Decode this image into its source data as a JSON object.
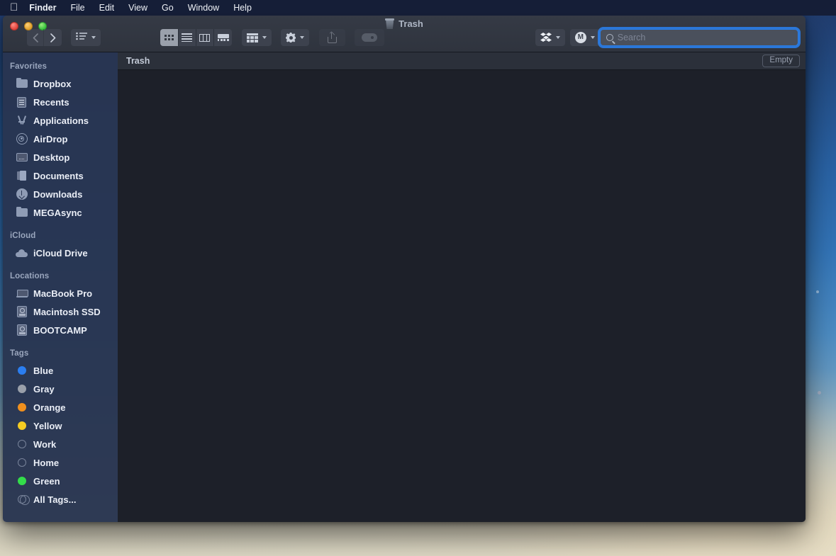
{
  "menubar": {
    "apple_icon": "apple-logo-icon",
    "items": [
      {
        "label": "Finder",
        "bold": true
      },
      {
        "label": "File",
        "bold": false
      },
      {
        "label": "Edit",
        "bold": false
      },
      {
        "label": "View",
        "bold": false
      },
      {
        "label": "Go",
        "bold": false
      },
      {
        "label": "Window",
        "bold": false
      },
      {
        "label": "Help",
        "bold": false
      }
    ]
  },
  "window": {
    "title": "Trash",
    "title_icon": "trash-can-icon",
    "traffic_lights": {
      "close": "close-window-button",
      "minimize": "minimize-window-button",
      "zoom": "zoom-window-button"
    }
  },
  "toolbar": {
    "back_label": "‹",
    "forward_label": "›",
    "group_menu_icon": "list-bullet-icon",
    "view_modes": [
      {
        "name": "icon-view",
        "active": true
      },
      {
        "name": "list-view",
        "active": false
      },
      {
        "name": "column-view",
        "active": false
      },
      {
        "name": "gallery-view",
        "active": false
      }
    ],
    "arrange_icon": "arrange-grid-icon",
    "action_icon": "gear-icon",
    "share_icon": "share-icon",
    "tag_icon": "tag-icon",
    "dropbox_icon": "dropbox-icon",
    "mega_icon": "mega-icon",
    "mega_letter": "M"
  },
  "search": {
    "placeholder": "Search",
    "value": "",
    "icon": "search-icon",
    "focused": true
  },
  "sidebar": {
    "sections": [
      {
        "title": "Favorites",
        "items": [
          {
            "label": "Dropbox",
            "icon": "folder-icon"
          },
          {
            "label": "Recents",
            "icon": "recents-icon"
          },
          {
            "label": "Applications",
            "icon": "applications-icon"
          },
          {
            "label": "AirDrop",
            "icon": "airdrop-icon"
          },
          {
            "label": "Desktop",
            "icon": "desktop-icon"
          },
          {
            "label": "Documents",
            "icon": "documents-icon"
          },
          {
            "label": "Downloads",
            "icon": "downloads-icon"
          },
          {
            "label": "MEGAsync",
            "icon": "folder-icon"
          }
        ]
      },
      {
        "title": "iCloud",
        "items": [
          {
            "label": "iCloud Drive",
            "icon": "cloud-icon"
          }
        ]
      },
      {
        "title": "Locations",
        "items": [
          {
            "label": "MacBook Pro",
            "icon": "laptop-icon"
          },
          {
            "label": "Macintosh SSD",
            "icon": "hard-drive-icon"
          },
          {
            "label": "BOOTCAMP",
            "icon": "hard-drive-icon"
          }
        ]
      },
      {
        "title": "Tags",
        "items": [
          {
            "label": "Blue",
            "icon": "tag-dot-icon",
            "color": "#2b7ef0"
          },
          {
            "label": "Gray",
            "icon": "tag-dot-icon",
            "color": "#9aa0aa"
          },
          {
            "label": "Orange",
            "icon": "tag-dot-icon",
            "color": "#f0901e"
          },
          {
            "label": "Yellow",
            "icon": "tag-dot-icon",
            "color": "#f5cc22"
          },
          {
            "label": "Work",
            "icon": "tag-dot-icon",
            "color": "none"
          },
          {
            "label": "Home",
            "icon": "tag-dot-icon",
            "color": "none"
          },
          {
            "label": "Green",
            "icon": "tag-dot-icon",
            "color": "#33dd4a"
          },
          {
            "label": "All Tags...",
            "icon": "all-tags-icon",
            "color": "none"
          }
        ]
      }
    ]
  },
  "content": {
    "title": "Trash",
    "empty_button_label": "Empty",
    "items": []
  },
  "colors": {
    "accent": "#2a7ce4",
    "sidebar_bg": "#283551",
    "content_bg": "#1d2029",
    "toolbar_bg": "#32374222"
  }
}
